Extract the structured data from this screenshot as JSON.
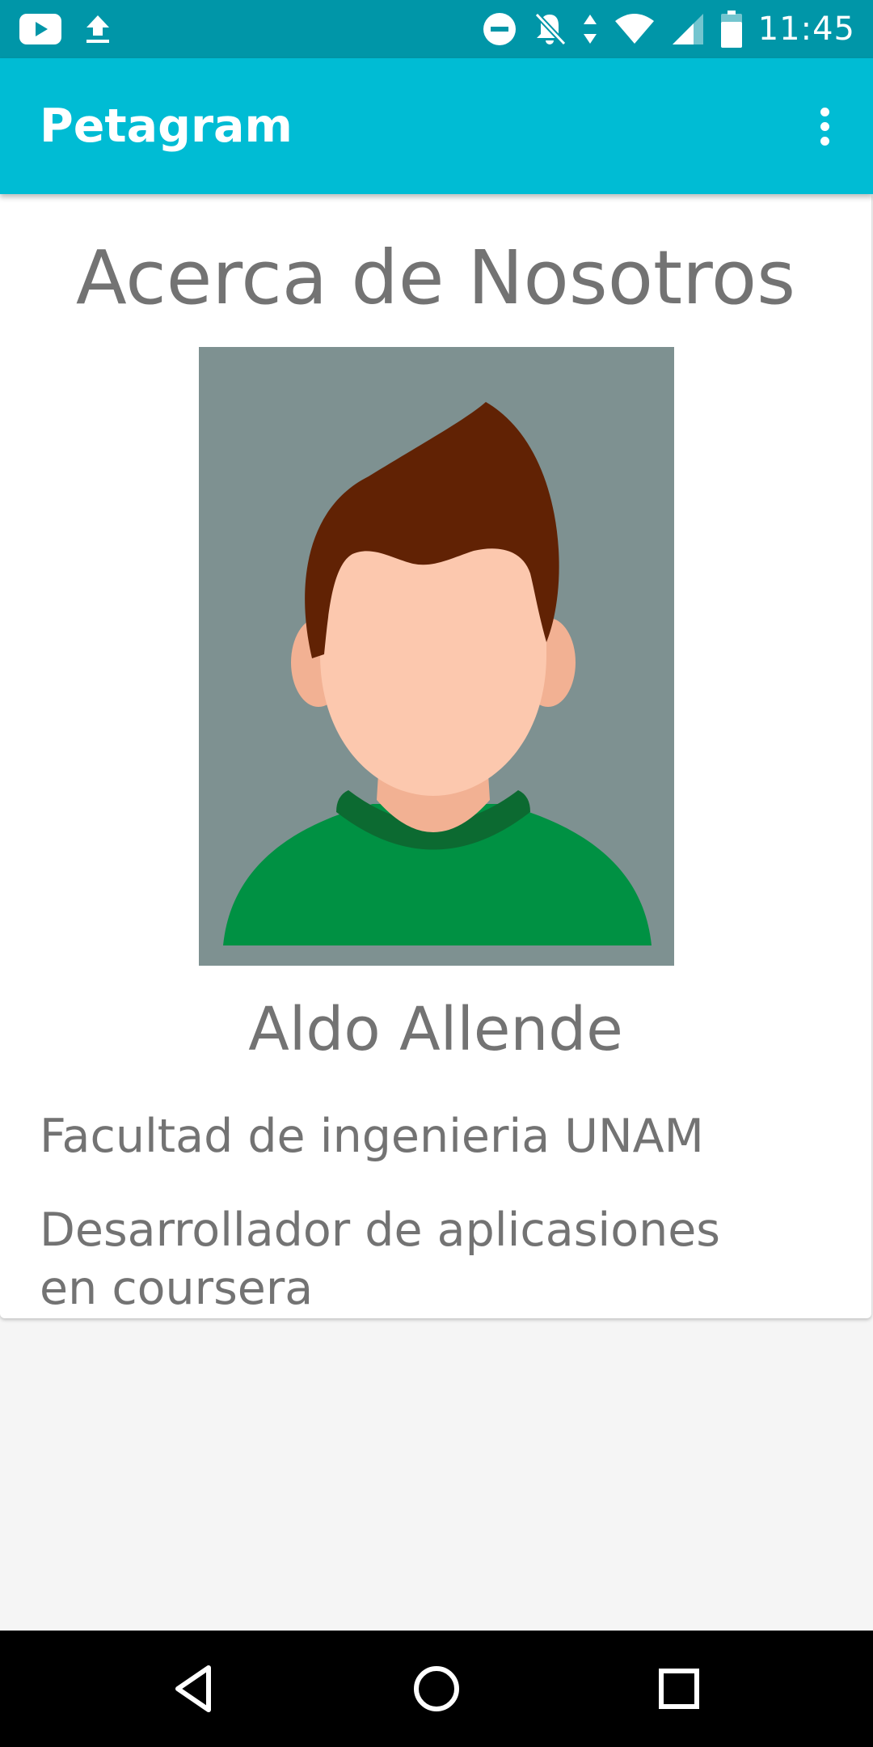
{
  "status_bar": {
    "time": "11:45",
    "left_icons": [
      "youtube-icon",
      "upload-icon"
    ],
    "right_icons": [
      "do-not-disturb-icon",
      "notifications-off-icon",
      "data-arrows-icon",
      "wifi-icon",
      "signal-icon",
      "battery-icon"
    ]
  },
  "app_bar": {
    "title": "Petagram",
    "menu_icon": "more-vert-icon"
  },
  "about": {
    "title": "Acerca de Nosotros",
    "avatar_icon": "avatar-illustration",
    "name": "Aldo Allende",
    "line1": "Facultad de ingenieria UNAM",
    "line2": "Desarrollador de aplicasiones en coursera"
  },
  "nav_bar": {
    "back_icon": "back-icon",
    "home_icon": "home-icon",
    "recents_icon": "recents-icon"
  },
  "colors": {
    "status_bar": "#0096a8",
    "app_bar": "#00bcd4",
    "text_gray": "#737373",
    "avatar_bg": "#7e9191",
    "hair": "#612204",
    "skin": "#fcc8ae",
    "shirt": "#009143"
  }
}
